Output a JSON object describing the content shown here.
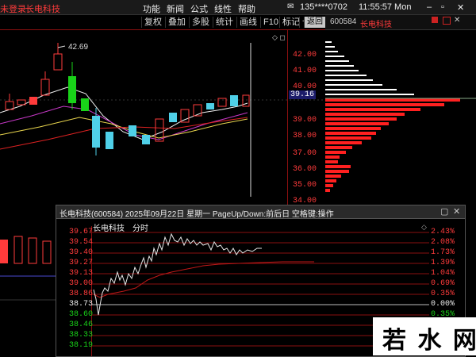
{
  "titlebar": {
    "login": "未登录",
    "stock_title": "长电科技",
    "menus": [
      "功能",
      "新闻",
      "公式",
      "线性",
      "帮助"
    ],
    "phone": "135****0702",
    "time": "11:55:57 Mon"
  },
  "toolbar": {
    "buttons": [
      "复权",
      "叠加",
      "多股",
      "统计",
      "画线",
      "F10",
      "标记",
      "+自选",
      "返回"
    ],
    "active_index": 8,
    "right_code": "600584",
    "right_name": "长电科技"
  },
  "main_chart": {
    "peak_label": "42.69",
    "price_marker": "39.16",
    "price_axis": [
      "42.00",
      "41.00",
      "40.00",
      "39.00",
      "38.00",
      "37.00",
      "36.00",
      "35.00",
      "34.00"
    ]
  },
  "popup": {
    "title": "长电科技(600584) 2025年09月22日 星期一 PageUp/Down:前后日 空格键:操作",
    "chart_title": "长电科技",
    "chart_subtitle": "分时",
    "prices_left": [
      "39.67",
      "39.54",
      "39.40",
      "39.27",
      "39.13",
      "39.00",
      "38.86",
      "38.73",
      "38.60",
      "38.46",
      "38.33",
      "38.19"
    ],
    "percents_right": [
      "2.43%",
      "2.08%",
      "1.73%",
      "1.39%",
      "1.04%",
      "0.69%",
      "0.35%",
      "0.00%",
      "0.35%"
    ],
    "ref_price": "38.73",
    "ref_percent": "0.00%"
  },
  "watermark": {
    "text": "若 水 网"
  },
  "colors": {
    "up": "#ff3b3b",
    "down": "#19d219",
    "cyan": "#4fd0e8",
    "yellow": "#e8d44d",
    "bg": "#000000"
  }
}
